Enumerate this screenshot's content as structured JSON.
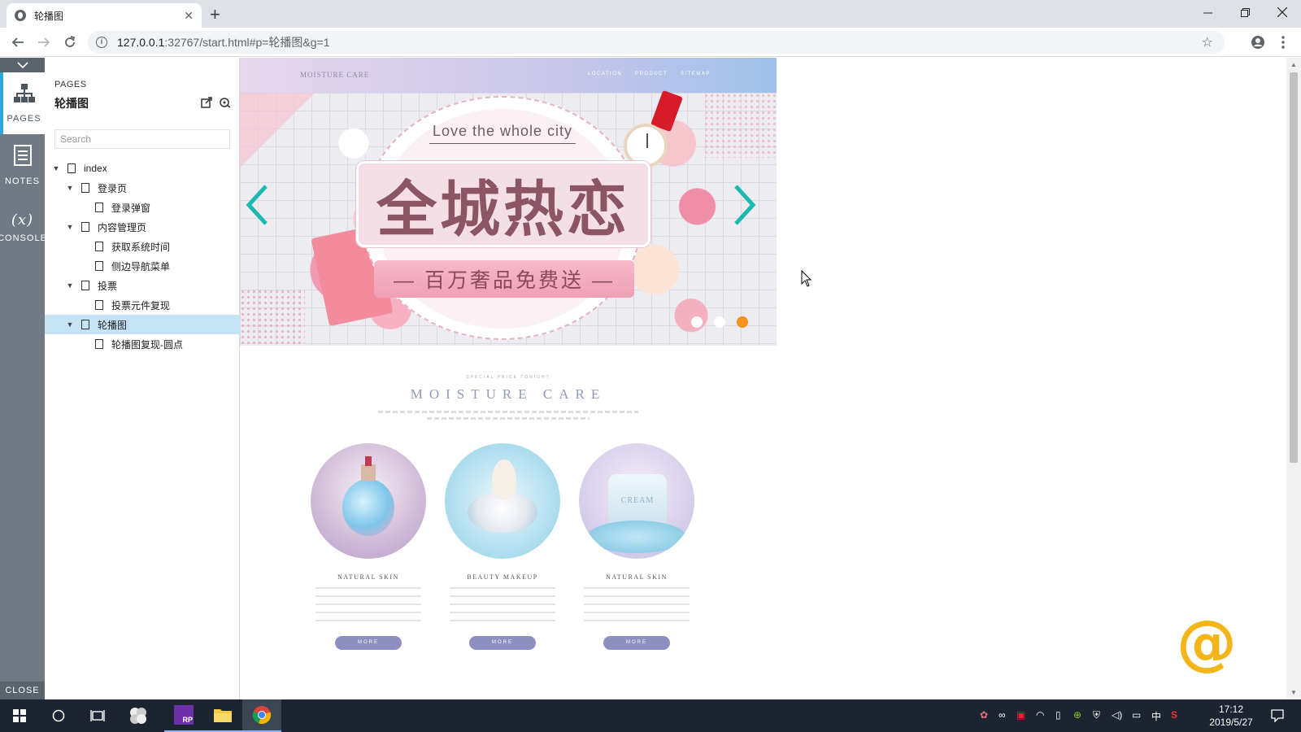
{
  "browser": {
    "tab_title": "轮播图",
    "tab_close": "✕",
    "new_tab": "+",
    "url_host": "127.0.0.1",
    "url_rest": ":32767/start.html#p=轮播图&g=1"
  },
  "axure": {
    "sidebar": {
      "pages_label": "PAGES",
      "notes_label": "NOTES",
      "console_label": "CONSOLE",
      "close_label": "CLOSE"
    },
    "panel": {
      "heading": "PAGES",
      "current_page": "轮播图",
      "search_placeholder": "Search"
    },
    "tree": [
      {
        "label": "index",
        "level": 0,
        "toggle": "▼"
      },
      {
        "label": "登录页",
        "level": 1,
        "toggle": "▼"
      },
      {
        "label": "登录弹窗",
        "level": 2,
        "toggle": ""
      },
      {
        "label": "内容管理页",
        "level": 1,
        "toggle": "▼"
      },
      {
        "label": "获取系统时间",
        "level": 2,
        "toggle": ""
      },
      {
        "label": "侧边导航菜单",
        "level": 2,
        "toggle": ""
      },
      {
        "label": "投票",
        "level": 1,
        "toggle": "▼"
      },
      {
        "label": "投票元件复现",
        "level": 2,
        "toggle": ""
      },
      {
        "label": "轮播图",
        "level": 1,
        "toggle": "▼",
        "selected": true
      },
      {
        "label": "轮播图复现-圆点",
        "level": 2,
        "toggle": ""
      }
    ]
  },
  "banner": {
    "nav_logo": "MOISTURE CARE",
    "nav_links": [
      "LOCATION",
      "PRODUCT",
      "SITEMAP"
    ],
    "tagline": "Love the whole city",
    "title": "全城热恋",
    "subtitle": "— 百万奢品免费送 —",
    "active_dot": 3,
    "arrow_color": "#1ab8b0",
    "dot_active_color": "#f7931e"
  },
  "section": {
    "kicker": "SPECIAL PRICE TONIGHT",
    "heading": "MOISTURE CARE",
    "products": [
      {
        "name": "NATURAL SKIN",
        "more": "MORE",
        "image": "perfume-bottle"
      },
      {
        "name": "BEAUTY MAKEUP",
        "more": "MORE",
        "image": "cream-splash"
      },
      {
        "name": "NATURAL SKIN",
        "more": "MORE",
        "image": "cream-jar",
        "jar_label": "CREAM"
      }
    ]
  },
  "taskbar": {
    "time": "17:12",
    "date": "2019/5/27",
    "ime": "中"
  }
}
